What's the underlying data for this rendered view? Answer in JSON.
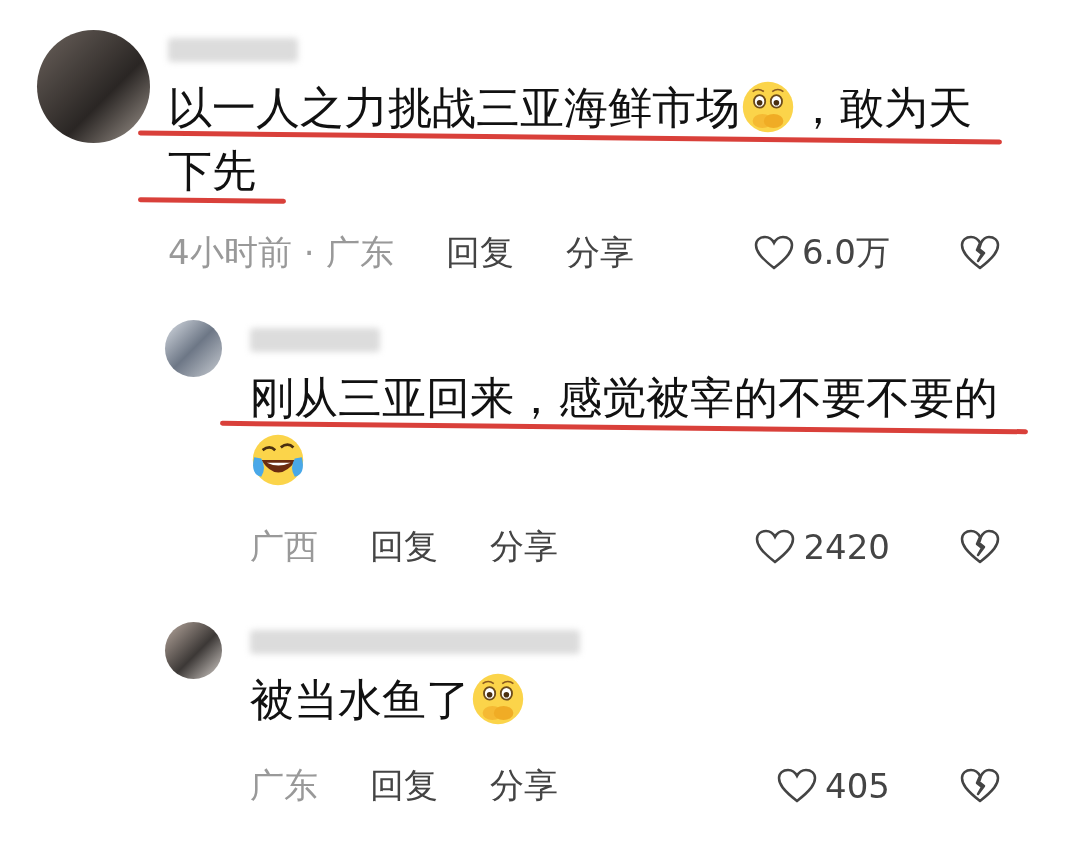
{
  "comments": [
    {
      "kind": "comment",
      "underlined": true,
      "content": [
        {
          "kind": "text",
          "text": "以一人之力挑战三亚海鲜市场"
        },
        {
          "kind": "shy-emoji"
        },
        {
          "kind": "text",
          "text": "，敢为天下先"
        }
      ],
      "time": "4小时前",
      "separator": "·",
      "location": "广东",
      "reply": "回复",
      "share": "分享",
      "likes": "6.0万"
    },
    {
      "kind": "reply",
      "underlined": true,
      "content": [
        {
          "kind": "text",
          "text": "刚从三亚回来，感觉被宰的不要不要的"
        },
        {
          "kind": "laugh-cry-emoji"
        }
      ],
      "location": "广西",
      "reply": "回复",
      "share": "分享",
      "likes": "2420"
    },
    {
      "kind": "reply",
      "underlined": false,
      "content": [
        {
          "kind": "text",
          "text": "被当水鱼了"
        },
        {
          "kind": "shy-emoji"
        }
      ],
      "location": "广东",
      "reply": "回复",
      "share": "分享",
      "likes": "405"
    }
  ]
}
